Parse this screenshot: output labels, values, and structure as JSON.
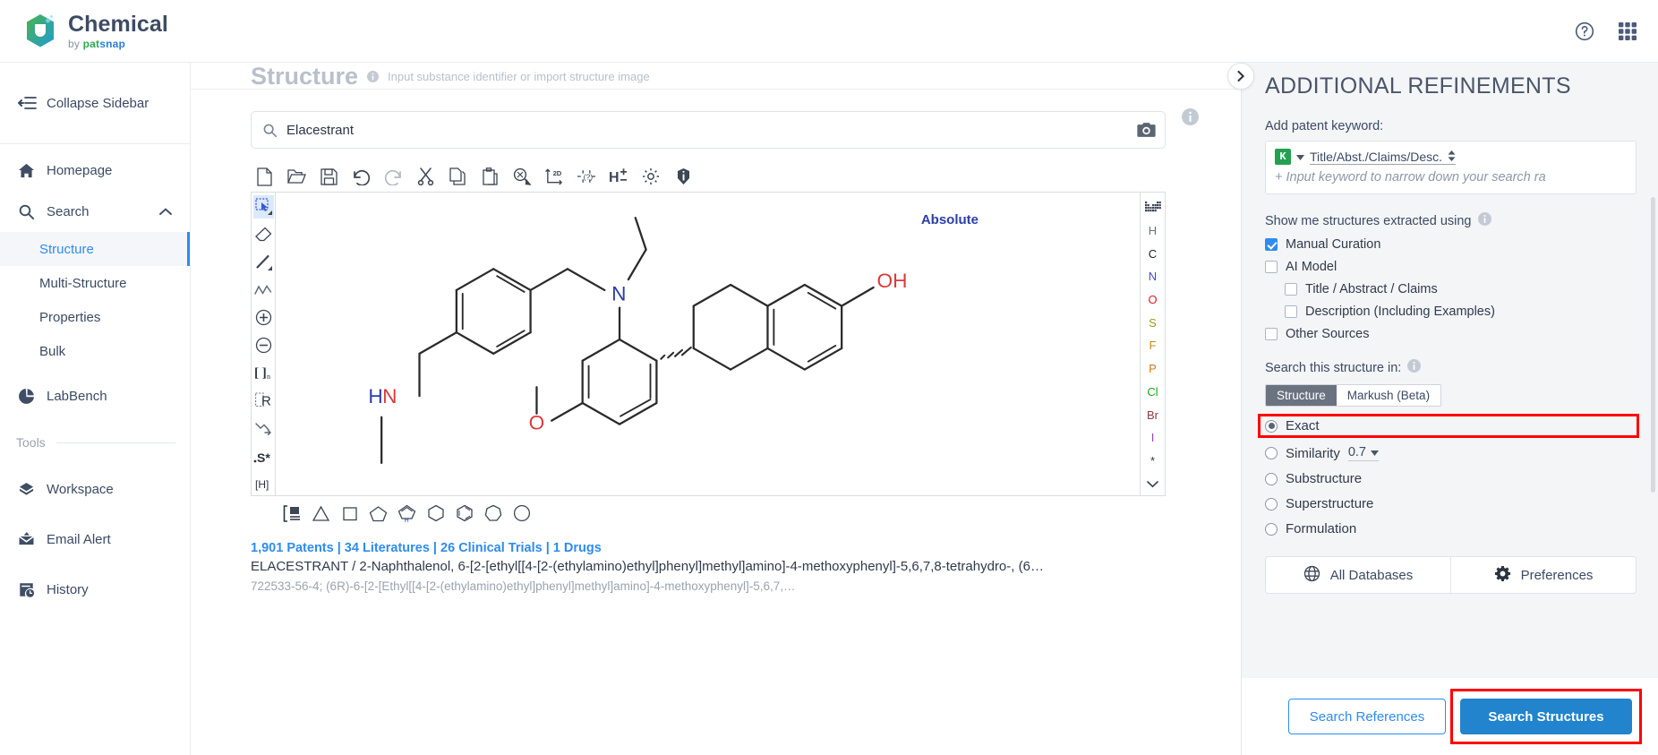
{
  "topbar": {
    "brand_name": "Chemical",
    "brand_by": "by",
    "brand_pat": "pat",
    "brand_snap": "snap",
    "help_icon": "help-circle-icon",
    "apps_icon": "apps-grid-icon"
  },
  "sidebar": {
    "collapse_label": "Collapse Sidebar",
    "items": [
      {
        "label": "Homepage",
        "icon": "home-icon"
      },
      {
        "label": "Search",
        "icon": "search-icon",
        "expanded": true
      }
    ],
    "search_children": [
      {
        "label": "Structure",
        "active": true
      },
      {
        "label": "Multi-Structure",
        "active": false
      },
      {
        "label": "Properties",
        "active": false
      },
      {
        "label": "Bulk",
        "active": false
      }
    ],
    "labbench": {
      "label": "LabBench",
      "icon": "pie-chart-icon"
    },
    "tools_header": "Tools",
    "tools": [
      {
        "label": "Workspace",
        "icon": "cube-icon"
      },
      {
        "label": "Email Alert",
        "icon": "mail-alert-icon"
      },
      {
        "label": "History",
        "icon": "history-clock-icon"
      }
    ]
  },
  "main": {
    "title": "Structure",
    "hint": "Input substance identifier or import structure image",
    "info_icon": "info-circle-icon",
    "search": {
      "value": "Elacestrant",
      "placeholder": "Input substance identifier or import structure image",
      "search_icon": "search-icon",
      "camera_icon": "camera-icon",
      "info_icon": "info-circle-icon"
    },
    "editor": {
      "toolbar": [
        {
          "name": "new-file-icon",
          "title": "New"
        },
        {
          "name": "open-folder-icon",
          "title": "Open"
        },
        {
          "name": "save-disk-icon",
          "title": "Save"
        },
        {
          "name": "undo-icon",
          "title": "Undo"
        },
        {
          "name": "redo-icon",
          "title": "Redo"
        },
        {
          "name": "cut-scissors-icon",
          "title": "Cut"
        },
        {
          "name": "copy-icon",
          "title": "Copy"
        },
        {
          "name": "paste-icon",
          "title": "Paste"
        },
        {
          "name": "zoom-select-icon",
          "title": "Zoom"
        },
        {
          "name": "layout-2d-icon",
          "title": "2D Layout"
        },
        {
          "name": "query-bond-icon",
          "title": "Query"
        },
        {
          "name": "hydrogen-toggle-icon",
          "title": "H +/-"
        },
        {
          "name": "settings-gear-icon",
          "title": "Settings"
        },
        {
          "name": "info-filled-icon",
          "title": "About"
        }
      ],
      "left_tools": [
        {
          "name": "select-lasso-icon",
          "selected": true
        },
        {
          "name": "eraser-icon",
          "selected": false
        },
        {
          "name": "bond-single-icon",
          "selected": false
        },
        {
          "name": "chain-icon",
          "selected": false
        },
        {
          "name": "charge-plus-icon",
          "selected": false
        },
        {
          "name": "charge-minus-icon",
          "selected": false
        },
        {
          "name": "bracket-n-icon",
          "selected": false,
          "label": "[ ]n"
        },
        {
          "name": "r-group-icon",
          "selected": false,
          "label": "R"
        },
        {
          "name": "reaction-arrow-icon",
          "selected": false
        },
        {
          "name": "stereo-s-icon",
          "selected": false,
          "label": ".S*"
        },
        {
          "name": "explicit-hydrogen-icon",
          "selected": false,
          "label": "[H]"
        }
      ],
      "elements": [
        "H",
        "C",
        "N",
        "O",
        "S",
        "F",
        "P",
        "Cl",
        "Br",
        "I",
        "*"
      ],
      "element_colors": {
        "H": "#6b7280",
        "C": "#222222",
        "N": "#3f4cc4",
        "O": "#e02020",
        "S": "#9a9a1e",
        "F": "#c98a16",
        "P": "#d07a12",
        "Cl": "#1ba81b",
        "Br": "#8c3a3a",
        "I": "#9b3fc4",
        "*": "#333333"
      },
      "periodic_icon": "periodic-table-icon",
      "more_icon": "chevron-down-icon",
      "rings": [
        {
          "name": "template-icon"
        },
        {
          "name": "cyclopropane-triangle-icon"
        },
        {
          "name": "cyclobutane-square-icon"
        },
        {
          "name": "cyclopentane-pentagon-icon"
        },
        {
          "name": "pyrrole-icon"
        },
        {
          "name": "cyclohexane-hexagon-icon"
        },
        {
          "name": "benzene-icon"
        },
        {
          "name": "cycloheptane-icon"
        },
        {
          "name": "cyclooctane-icon"
        }
      ],
      "canvas_label": "Absolute",
      "molecule_atoms": [
        "HN",
        "N",
        "O",
        "OH"
      ]
    },
    "results": {
      "links": "1,901 Patents | 34 Literatures | 26 Clinical Trials | 1 Drugs",
      "link_parts": [
        "1,901 Patents",
        "34 Literatures",
        "26 Clinical Trials",
        "1 Drugs"
      ],
      "name": "ELACESTRANT / 2-Naphthalenol, 6-[2-[ethyl[[4-[2-(ethylamino)ethyl]phenyl]methyl]amino]-4-methoxyphenyl]-5,6,7,8-tetrahydro-, (6…",
      "cas": "722533-56-4; (6R)-6-[2-[Ethyl[[4-[2-(ethylamino)ethyl]phenyl]methyl]amino]-4-methoxyphenyl]-5,6,7,…"
    }
  },
  "refinements": {
    "collapse_icon": "chevron-right-icon",
    "title": "ADDITIONAL REFINEMENTS",
    "keyword_label": "Add patent keyword:",
    "keyword_badge": "K",
    "keyword_field_select": "Title/Abst./Claims/Desc.",
    "keyword_placeholder": "+ Input keyword to narrow down your search ra",
    "extracted_label": "Show me structures extracted using",
    "extracted_info_icon": "info-circle-icon",
    "checkboxes": [
      {
        "label": "Manual Curation",
        "checked": true,
        "indent": false
      },
      {
        "label": "AI Model",
        "checked": false,
        "indent": false
      },
      {
        "label": "Title / Abstract / Claims",
        "checked": false,
        "indent": true
      },
      {
        "label": "Description (Including Examples)",
        "checked": false,
        "indent": true
      },
      {
        "label": "Other Sources",
        "checked": false,
        "indent": false
      }
    ],
    "search_in_label": "Search this structure in:",
    "search_in_info_icon": "info-circle-icon",
    "tabs": [
      {
        "label": "Structure",
        "active": true
      },
      {
        "label": "Markush (Beta)",
        "active": false
      }
    ],
    "modes": [
      {
        "label": "Exact",
        "selected": true,
        "highlighted": true
      },
      {
        "label": "Similarity",
        "selected": false,
        "value": "0.7"
      },
      {
        "label": "Substructure",
        "selected": false
      },
      {
        "label": "Superstructure",
        "selected": false
      },
      {
        "label": "Formulation",
        "selected": false
      }
    ],
    "db_buttons": [
      {
        "label": "All Databases",
        "icon": "globe-icon"
      },
      {
        "label": "Preferences",
        "icon": "gear-icon"
      }
    ],
    "footer": {
      "search_references": "Search References",
      "search_structures": "Search Structures"
    }
  },
  "colors": {
    "accent": "#2d8cf0",
    "primary_button": "#2184cd",
    "highlight": "#ff0000",
    "brand_green": "#2fa84f",
    "brand_blue": "#2d7fd6",
    "panel_bg": "#f4f5f7",
    "text": "#3b4a63"
  }
}
